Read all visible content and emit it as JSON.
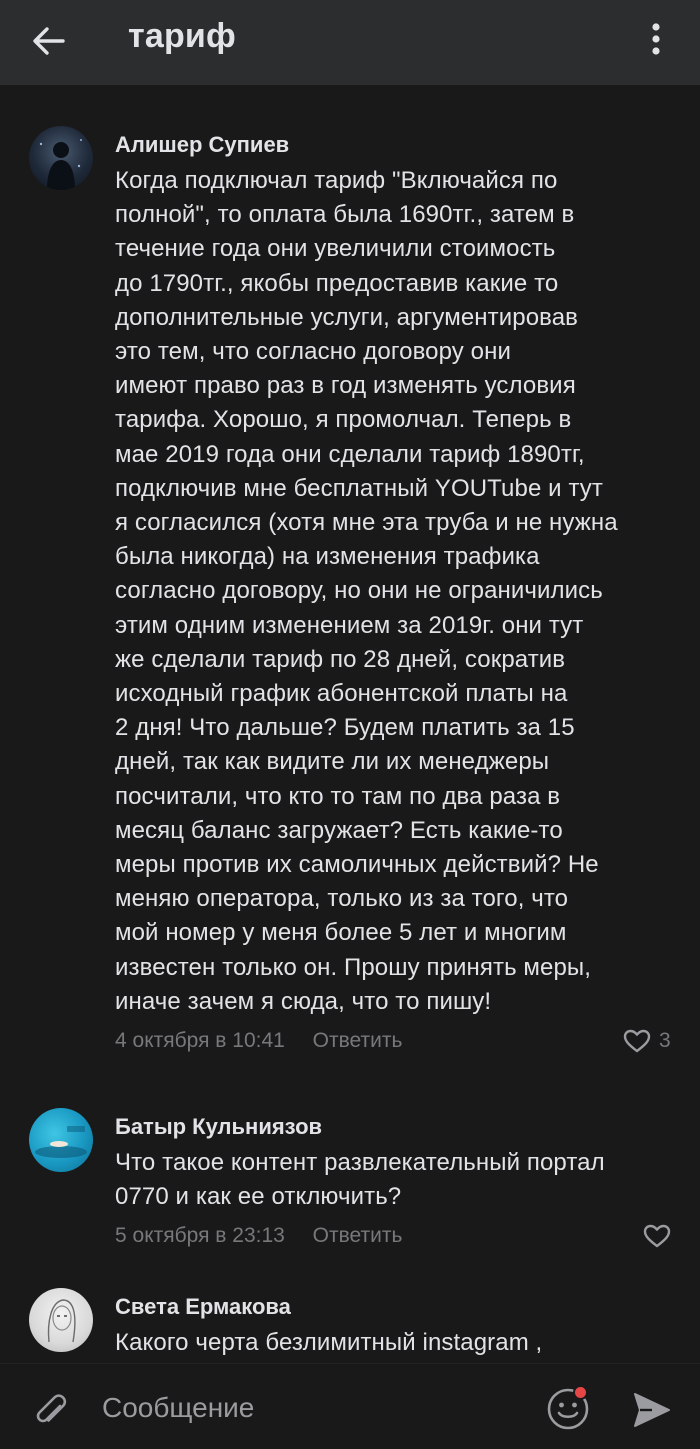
{
  "header": {
    "title": "тариф",
    "back_icon": "arrow-left-icon",
    "menu_icon": "more-vertical-icon"
  },
  "comments": [
    {
      "author": "Алишер Супиев",
      "text": "Когда подключал тариф \"Включайся по\nполной\", то оплата была 1690тг., затем в\nтечение года они увеличили стоимость\nдо 1790тг., якобы предоставив какие то\nдополнительные услуги, аргументировав\nэто тем, что согласно договору они\nимеют право раз в год изменять условия\nтарифа. Хорошо, я промолчал. Теперь в\nмае 2019 года они сделали тариф 1890тг,\nподключив мне бесплатный YOUTube и тут\nя согласился (хотя мне эта труба и не нужна\nбыла никогда) на изменения трафика\nсогласно договору, но они не ограничились\nэтим одним изменением за 2019г. они тут\nже сделали тариф по 28 дней, сократив\nисходный график абонентской платы на\n2 дня! Что дальше? Будем платить за 15\nдней, так как видите ли их менеджеры\nпосчитали, что кто то там по два раза в\nмесяц баланс загружает? Есть какие-то\nмеры против их самоличных действий? Не\nменяю оператора, только из за того, что\nмой номер у меня более 5 лет и многим\nизвестен только он. Прошу принять меры,\nиначе зачем я сюда, что то пишу!",
      "date": "4 октября в 10:41",
      "reply_label": "Ответить",
      "likes": "3"
    },
    {
      "author": "Батыр Кульниязов",
      "text": "Что такое контент развлекательный портал\n0770 и как ее отключить?",
      "date": "5 октября в 23:13",
      "reply_label": "Ответить",
      "likes": ""
    },
    {
      "author": "Света Ермакова",
      "text": "Какого черта безлимитный instagram ,"
    }
  ],
  "composer": {
    "placeholder": "Сообщение",
    "attach_icon": "paperclip-icon",
    "emoji_icon": "smile-icon",
    "send_icon": "send-icon"
  },
  "colors": {
    "background": "#19191a",
    "header": "#2c2d2e",
    "text_primary": "#e1e3e6",
    "text_secondary": "#76787a",
    "notification_dot": "#e64646"
  }
}
